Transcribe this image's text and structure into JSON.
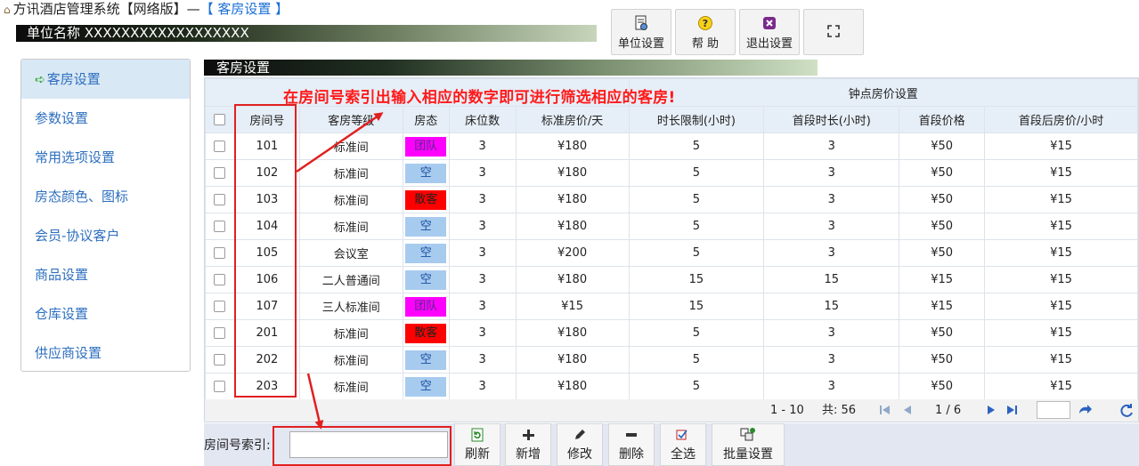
{
  "header": {
    "app_title": "方讯酒店管理系统【网络版】—",
    "section_title": "【 客房设置 】",
    "unit_name": "单位名称 XXXXXXXXXXXXXXXXXX"
  },
  "top_toolbar": {
    "unit_settings": "单位设置",
    "help": "帮 助",
    "exit_settings": "退出设置"
  },
  "sidebar": {
    "items": [
      {
        "label": "客房设置",
        "active": true
      },
      {
        "label": "参数设置"
      },
      {
        "label": "常用选项设置"
      },
      {
        "label": "房态颜色、图标"
      },
      {
        "label": "会员-协议客户"
      },
      {
        "label": "商品设置"
      },
      {
        "label": "仓库设置"
      },
      {
        "label": "供应商设置"
      }
    ]
  },
  "panel": {
    "title": "客房设置"
  },
  "annotation": "在房间号索引出输入相应的数字即可进行筛选相应的客房!",
  "table": {
    "group_header": "钟点房价设置",
    "columns": [
      "房间号",
      "客房等级",
      "房态",
      "床位数",
      "标准房价/天",
      "时长限制(小时)",
      "首段时长(小时)",
      "首段价格",
      "首段后房价/小时"
    ],
    "rows": [
      {
        "room": "101",
        "grade": "标准间",
        "status": "团队",
        "status_color": "#ff00ff",
        "beds": "3",
        "price": "¥180",
        "limit": "5",
        "first_hours": "3",
        "first_price": "¥50",
        "after_price": "¥15"
      },
      {
        "room": "102",
        "grade": "标准间",
        "status": "空",
        "status_color": "#a7cbef",
        "beds": "3",
        "price": "¥180",
        "limit": "5",
        "first_hours": "3",
        "first_price": "¥50",
        "after_price": "¥15"
      },
      {
        "room": "103",
        "grade": "标准间",
        "status": "散客",
        "status_color": "#ff0000",
        "beds": "3",
        "price": "¥180",
        "limit": "5",
        "first_hours": "3",
        "first_price": "¥50",
        "after_price": "¥15"
      },
      {
        "room": "104",
        "grade": "标准间",
        "status": "空",
        "status_color": "#a7cbef",
        "beds": "3",
        "price": "¥180",
        "limit": "5",
        "first_hours": "3",
        "first_price": "¥50",
        "after_price": "¥15"
      },
      {
        "room": "105",
        "grade": "会议室",
        "status": "空",
        "status_color": "#a7cbef",
        "beds": "3",
        "price": "¥200",
        "limit": "5",
        "first_hours": "3",
        "first_price": "¥50",
        "after_price": "¥15"
      },
      {
        "room": "106",
        "grade": "二人普通间",
        "status": "空",
        "status_color": "#a7cbef",
        "beds": "3",
        "price": "¥180",
        "limit": "15",
        "first_hours": "15",
        "first_price": "¥15",
        "after_price": "¥15"
      },
      {
        "room": "107",
        "grade": "三人标准间",
        "status": "团队",
        "status_color": "#ff00ff",
        "beds": "3",
        "price": "¥15",
        "limit": "15",
        "first_hours": "15",
        "first_price": "¥15",
        "after_price": "¥15"
      },
      {
        "room": "201",
        "grade": "标准间",
        "status": "散客",
        "status_color": "#ff0000",
        "beds": "3",
        "price": "¥180",
        "limit": "5",
        "first_hours": "3",
        "first_price": "¥50",
        "after_price": "¥15"
      },
      {
        "room": "202",
        "grade": "标准间",
        "status": "空",
        "status_color": "#a7cbef",
        "beds": "3",
        "price": "¥180",
        "limit": "5",
        "first_hours": "3",
        "first_price": "¥50",
        "after_price": "¥15"
      },
      {
        "room": "203",
        "grade": "标准间",
        "status": "空",
        "status_color": "#a7cbef",
        "beds": "3",
        "price": "¥180",
        "limit": "5",
        "first_hours": "3",
        "first_price": "¥50",
        "after_price": "¥15"
      }
    ]
  },
  "pager": {
    "range": "1 - 10",
    "total": "共: 56",
    "page_info": "1 / 6",
    "page_value": ""
  },
  "bottom_toolbar": {
    "search_label": "房间号索引:",
    "search_value": "",
    "refresh": "刷新",
    "add": "新增",
    "edit": "修改",
    "delete": "删除",
    "select_all": "全选",
    "batch": "批量设置"
  },
  "colors": {
    "accent_blue": "#2d6fbf",
    "annotation_red": "#ff1a1a",
    "header_bg": "#e6eef7"
  }
}
